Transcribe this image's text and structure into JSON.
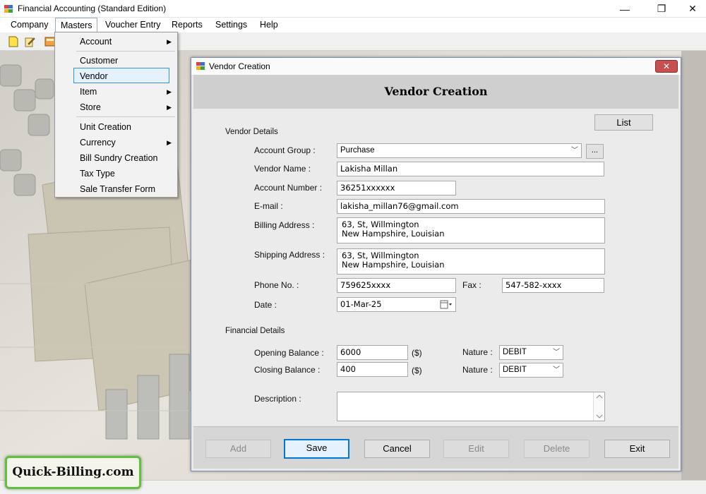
{
  "app": {
    "title": "Financial Accounting (Standard Edition)",
    "menu": [
      "Company",
      "Masters",
      "Voucher Entry",
      "Reports",
      "Settings",
      "Help"
    ],
    "window_controls": {
      "minimize": "—",
      "restore": "❐",
      "close": "✕"
    }
  },
  "masters_menu": {
    "items": [
      {
        "label": "Account",
        "submenu": true
      },
      {
        "label": "Customer",
        "submenu": false
      },
      {
        "label": "Vendor",
        "submenu": false,
        "highlighted": true
      },
      {
        "label": "Item",
        "submenu": true
      },
      {
        "label": "Store",
        "submenu": true
      },
      {
        "label": "Unit Creation",
        "submenu": false
      },
      {
        "label": "Currency",
        "submenu": true
      },
      {
        "label": "Bill Sundry Creation",
        "submenu": false
      },
      {
        "label": "Tax Type",
        "submenu": false
      },
      {
        "label": "Sale Transfer Form",
        "submenu": false
      }
    ],
    "arrow": "▶"
  },
  "dialog": {
    "title": "Vendor Creation",
    "heading": "Vendor Creation",
    "close_label": "✕",
    "list_button": "List",
    "vendor_details_label": "Vendor Details",
    "financial_details_label": "Financial Details",
    "fields": {
      "account_group": {
        "label": "Account Group :",
        "value": "Purchase",
        "browse": "..."
      },
      "vendor_name": {
        "label": "Vendor Name :",
        "value": "Lakisha Millan"
      },
      "account_number": {
        "label": "Account Number :",
        "value": "36251xxxxxx"
      },
      "email": {
        "label": "E-mail :",
        "value": "lakisha_millan76@gmail.com"
      },
      "billing_address": {
        "label": "Billing Address :",
        "value": "63, St, Willmington\nNew Hampshire, Louisian"
      },
      "shipping_address": {
        "label": "Shipping Address :",
        "value": "63, St, Willmington\nNew Hampshire, Louisian"
      },
      "phone": {
        "label": "Phone No. :",
        "value": "759625xxxx"
      },
      "fax": {
        "label": "Fax :",
        "value": "547-582-xxxx"
      },
      "date": {
        "label": "Date :",
        "value": "01-Mar-25"
      },
      "opening_balance": {
        "label": "Opening Balance :",
        "value": "6000",
        "unit": "($)",
        "nature_label": "Nature :",
        "nature": "DEBIT"
      },
      "closing_balance": {
        "label": "Closing Balance :",
        "value": "400",
        "unit": "($)",
        "nature_label": "Nature :",
        "nature": "DEBIT"
      },
      "description": {
        "label": "Description :",
        "value": ""
      }
    },
    "buttons": {
      "add": "Add",
      "save": "Save",
      "cancel": "Cancel",
      "edit": "Edit",
      "delete": "Delete",
      "exit": "Exit"
    }
  },
  "brand": {
    "logo_text": "Quick-Billing.com"
  },
  "colors": {
    "accent": "#0078d7",
    "logo_border": "#5fc23a",
    "close_red": "#c75050"
  }
}
